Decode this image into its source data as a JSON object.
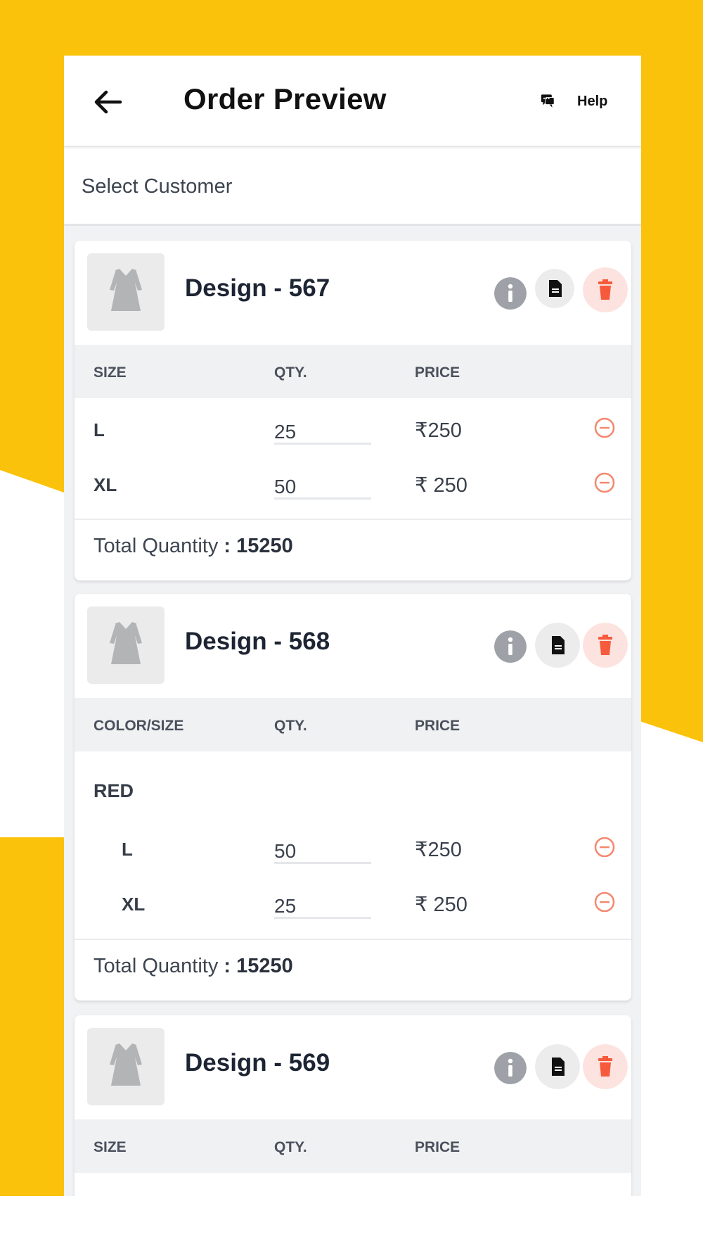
{
  "colors": {
    "accent_yellow": "#fbc20b",
    "delete_red": "#f65a3c",
    "delete_bg": "#fde3df",
    "remove_icon": "#f4886f"
  },
  "header": {
    "title": "Order Preview",
    "help_label": "Help"
  },
  "customer": {
    "label": "Select Customer"
  },
  "cards": [
    {
      "name": "Design - 567",
      "columns": [
        "SIZE",
        "QTY.",
        "PRICE"
      ],
      "rows": [
        {
          "size": "L",
          "qty": "25",
          "price": "₹250"
        },
        {
          "size": "XL",
          "qty": "50",
          "price": "₹ 250"
        }
      ],
      "total_label": "Total Quantity",
      "total_value": ": 15250"
    },
    {
      "name": "Design - 568",
      "columns": [
        "COLOR/SIZE",
        "QTY.",
        "PRICE"
      ],
      "group": "RED",
      "rows": [
        {
          "size": "L",
          "qty": "50",
          "price": "₹250"
        },
        {
          "size": "XL",
          "qty": "25",
          "price": "₹ 250"
        }
      ],
      "total_label": "Total Quantity",
      "total_value": ": 15250"
    },
    {
      "name": "Design - 569",
      "columns": [
        "SIZE",
        "QTY.",
        "PRICE"
      ]
    }
  ]
}
